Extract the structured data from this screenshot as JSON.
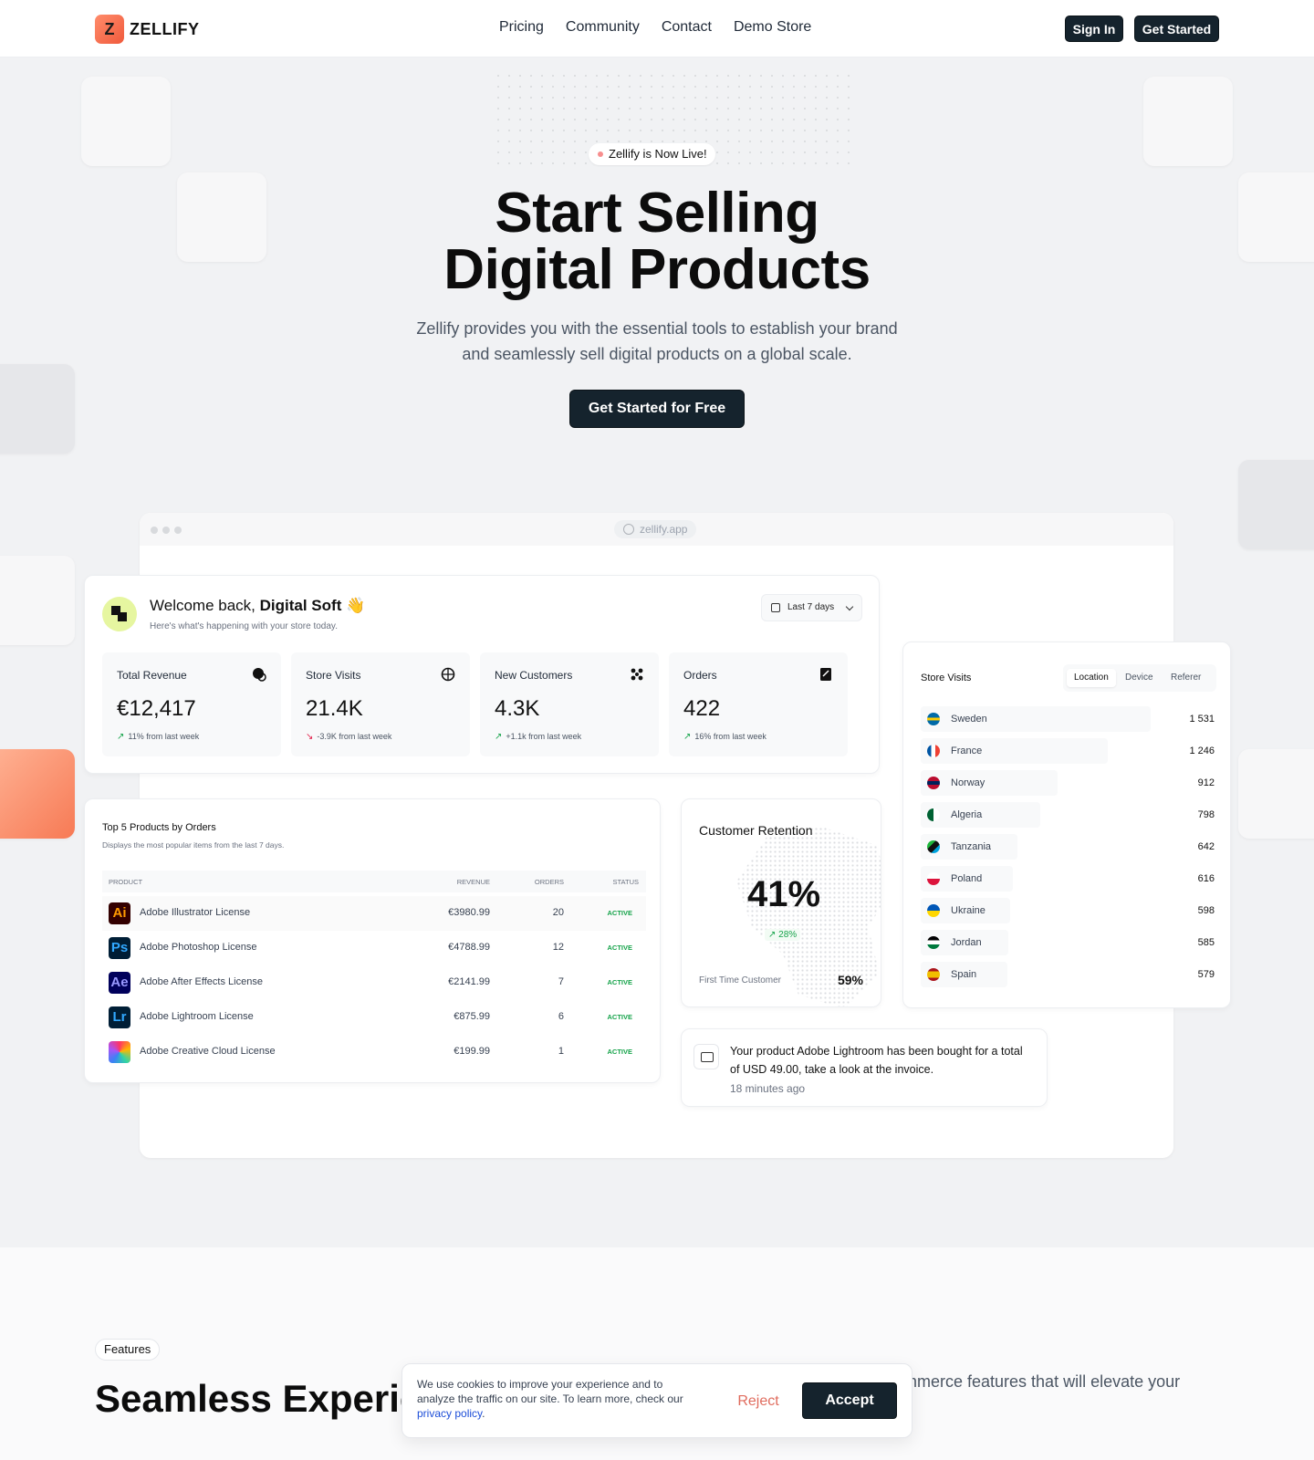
{
  "nav": {
    "brand": "ZELLIFY",
    "logo_glyph": "Z",
    "links": [
      "Pricing",
      "Community",
      "Contact",
      "Demo Store"
    ],
    "sign_in": "Sign In",
    "get_started": "Get Started"
  },
  "hero": {
    "badge": "Zellify is Now Live!",
    "title_line1": "Start Selling",
    "title_line2": "Digital Products",
    "subtitle_line1": "Zellify provides you with the essential tools to establish your brand",
    "subtitle_line2": "and seamlessly sell digital products on a global scale.",
    "cta": "Get Started for Free"
  },
  "browser": {
    "url": "zellify.app"
  },
  "dashboard": {
    "greeting_prefix": "Welcome back,",
    "greeting_name": "Digital Soft",
    "greeting_emoji": "👋",
    "greeting_sub": "Here's what's happening with your store today.",
    "range": "Last 7 days",
    "stats": [
      {
        "label": "Total Revenue",
        "value": "€12,417",
        "delta": "11% from last week",
        "trend": "up",
        "icon": "coin-icon"
      },
      {
        "label": "Store Visits",
        "value": "21.4K",
        "delta": "-3.9K from last week",
        "trend": "down",
        "icon": "globe-icon"
      },
      {
        "label": "New Customers",
        "value": "4.3K",
        "delta": "+1.1k from last week",
        "trend": "up",
        "icon": "users-icon"
      },
      {
        "label": "Orders",
        "value": "422",
        "delta": "16% from last week",
        "trend": "up",
        "icon": "receipt-icon"
      }
    ]
  },
  "products": {
    "title": "Top 5 Products by Orders",
    "subtitle": "Displays the most popular items from the last 7 days.",
    "columns": [
      "PRODUCT",
      "REVENUE",
      "ORDERS",
      "STATUS"
    ],
    "rows": [
      {
        "logo": "Ai",
        "name": "Adobe Illustrator License",
        "revenue": "€3980.99",
        "orders": "20",
        "status": "ACTIVE",
        "bg": "#330000",
        "fg": "#ff9a00"
      },
      {
        "logo": "Ps",
        "name": "Adobe Photoshop License",
        "revenue": "€4788.99",
        "orders": "12",
        "status": "ACTIVE",
        "bg": "#001e36",
        "fg": "#31a8ff"
      },
      {
        "logo": "Ae",
        "name": "Adobe After Effects License",
        "revenue": "€2141.99",
        "orders": "7",
        "status": "ACTIVE",
        "bg": "#00005b",
        "fg": "#9999ff"
      },
      {
        "logo": "Lr",
        "name": "Adobe Lightroom License",
        "revenue": "€875.99",
        "orders": "6",
        "status": "ACTIVE",
        "bg": "#001e36",
        "fg": "#31a8ff"
      },
      {
        "logo": "",
        "name": "Adobe Creative Cloud License",
        "revenue": "€199.99",
        "orders": "1",
        "status": "ACTIVE",
        "bg": "#ff4f6d",
        "fg": "#ffffff"
      }
    ]
  },
  "retention": {
    "title": "Customer Retention",
    "value": "41%",
    "delta": "28%",
    "label": "First Time Customer",
    "label_value": "59%"
  },
  "visits": {
    "title": "Store Visits",
    "tabs": [
      "Location",
      "Device",
      "Referer"
    ],
    "active_tab": "Location",
    "rows": [
      {
        "country": "Sweden",
        "count": "1 531",
        "value": 1531
      },
      {
        "country": "France",
        "count": "1 246",
        "value": 1246
      },
      {
        "country": "Norway",
        "count": "912",
        "value": 912
      },
      {
        "country": "Algeria",
        "count": "798",
        "value": 798
      },
      {
        "country": "Tanzania",
        "count": "642",
        "value": 642
      },
      {
        "country": "Poland",
        "count": "616",
        "value": 616
      },
      {
        "country": "Ukraine",
        "count": "598",
        "value": 598
      },
      {
        "country": "Jordan",
        "count": "585",
        "value": 585
      },
      {
        "country": "Spain",
        "count": "579",
        "value": 579
      }
    ]
  },
  "notification": {
    "text": "Your product Adobe Lightroom has been bought for a total of USD 49.00, take a look at the invoice.",
    "time": "18 minutes ago"
  },
  "features": {
    "badge": "Features",
    "title": "Seamless Experie",
    "subtitle": "mmerce features that will elevate your"
  },
  "cookie": {
    "text": "We use cookies to improve your experience and to analyze the traffic on our site. To learn more, check our",
    "link": "privacy policy",
    "reject": "Reject",
    "accept": "Accept"
  },
  "colors": {
    "primary_dark": "#15232d",
    "accent_orange": "#f77a55",
    "success": "#16a34a",
    "danger": "#e11d48"
  }
}
